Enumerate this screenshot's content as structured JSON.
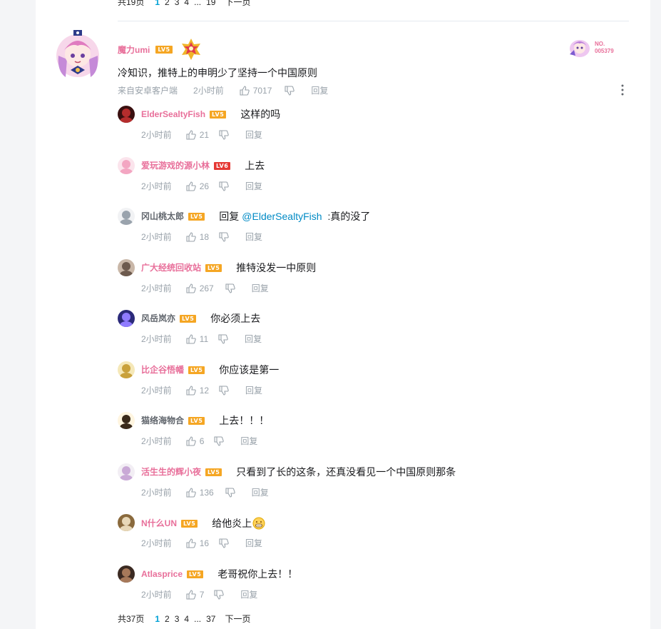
{
  "colors": {
    "accent": "#00a1d6",
    "username_pink": "#e86f9a",
    "meta_gray": "#99a2aa",
    "level_orange": "#f5a623",
    "level_red": "#e53935"
  },
  "top_pager": {
    "total": "共19页",
    "pages": [
      "1",
      "2",
      "3",
      "4"
    ],
    "ellipsis": "...",
    "last": "19",
    "next": "下一页"
  },
  "main_comment": {
    "username": "魔力umi",
    "level": "LV5",
    "fan_badge_text": "NO.\n005379",
    "content": "冷知识，推特上的申明少了坚持一个中国原则",
    "source": "来自安卓客户端",
    "time": "2小时前",
    "likes": "7017",
    "reply_label": "回复"
  },
  "replies": [
    {
      "username": "ElderSealtyFish",
      "level": "LV5",
      "level_color": "orange",
      "name_color": "pink",
      "content": "这样的吗",
      "time": "2小时前",
      "likes": "21",
      "reply_label": "回复",
      "avatar": "dark-red"
    },
    {
      "username": "爱玩游戏的源小林",
      "level": "LV6",
      "level_color": "red",
      "name_color": "pink",
      "content": "上去",
      "time": "2小时前",
      "likes": "26",
      "reply_label": "回复",
      "avatar": "pink-anime"
    },
    {
      "username": "冈山桃太郎",
      "level": "LV5",
      "level_color": "orange",
      "name_color": "plain",
      "prefix": "回复",
      "mention": "@ElderSealtyFish",
      "content": ":真的没了",
      "time": "2小时前",
      "likes": "18",
      "reply_label": "回复",
      "avatar": "sketch"
    },
    {
      "username": "广大经统回收站",
      "level": "LV5",
      "level_color": "orange",
      "name_color": "pink",
      "content": "推特没发一中原则",
      "time": "2小时前",
      "likes": "267",
      "reply_label": "回复",
      "avatar": "photo"
    },
    {
      "username": "风岳岚亦",
      "level": "LV5",
      "level_color": "orange",
      "name_color": "plain",
      "content": "你必须上去",
      "time": "2小时前",
      "likes": "11",
      "reply_label": "回复",
      "avatar": "purple"
    },
    {
      "username": "比企谷悟幡",
      "level": "LV5",
      "level_color": "orange",
      "name_color": "pink",
      "content": "你应该是第一",
      "time": "2小时前",
      "likes": "12",
      "reply_label": "回复",
      "avatar": "yellow"
    },
    {
      "username": "猫络海物合",
      "level": "LV5",
      "level_color": "orange",
      "name_color": "plain",
      "content": "上去！！！",
      "time": "2小时前",
      "likes": "6",
      "reply_label": "回复",
      "avatar": "cartoon"
    },
    {
      "username": "活生生的辉小夜",
      "level": "LV5",
      "level_color": "orange",
      "name_color": "pink",
      "content": "只看到了长的这条，还真没看见一个中国原则那条",
      "time": "2小时前",
      "likes": "136",
      "reply_label": "回复",
      "avatar": "white-hair"
    },
    {
      "username": "N什么UN",
      "level": "LV5",
      "level_color": "orange",
      "name_color": "pink",
      "content": "给他炎上",
      "emoji": "grin-emoji",
      "time": "2小时前",
      "likes": "16",
      "reply_label": "回复",
      "avatar": "brown"
    },
    {
      "username": "Atlasprice",
      "level": "LV5",
      "level_color": "orange",
      "name_color": "pink",
      "content": "老哥祝你上去！！",
      "time": "2小时前",
      "likes": "7",
      "reply_label": "回复",
      "avatar": "dark-photo"
    }
  ],
  "bottom_pager": {
    "total": "共37页",
    "pages": [
      "1",
      "2",
      "3",
      "4"
    ],
    "ellipsis": "...",
    "last": "37",
    "next": "下一页"
  }
}
